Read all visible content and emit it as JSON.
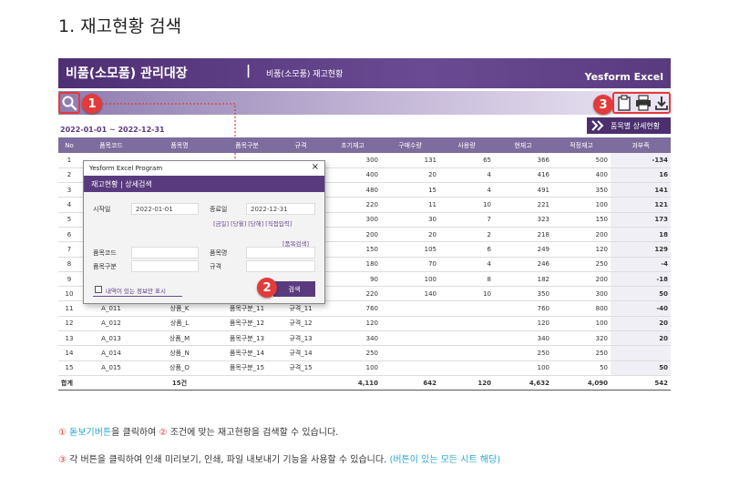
{
  "title": "1. 재고현황 검색",
  "header": {
    "title": "비품(소모품) 관리대장",
    "divider": "|",
    "subtitle": "비품(소모품) 재고현황",
    "brand": "Yesform Excel"
  },
  "toolbar": {
    "icons": [
      "search-icon",
      "clipboard-icon",
      "print-icon",
      "download-icon"
    ]
  },
  "badges": {
    "b1": "1",
    "b2": "2",
    "b3": "3"
  },
  "detail_button": "품목별 상세현황",
  "date_range": "2022-01-01 ~ 2022-12-31",
  "table": {
    "columns": [
      "No",
      "품목코드",
      "품목명",
      "품목구분",
      "규격",
      "초기재고",
      "구매수량",
      "사용량",
      "현재고",
      "적정재고",
      "과부족"
    ],
    "rows": [
      [
        "1",
        "",
        "",
        "",
        "",
        "300",
        "131",
        "65",
        "366",
        "500",
        "-134"
      ],
      [
        "2",
        "",
        "",
        "",
        "",
        "400",
        "20",
        "4",
        "416",
        "400",
        "16"
      ],
      [
        "3",
        "",
        "",
        "",
        "",
        "480",
        "15",
        "4",
        "491",
        "350",
        "141"
      ],
      [
        "4",
        "",
        "",
        "",
        "",
        "220",
        "11",
        "10",
        "221",
        "100",
        "121"
      ],
      [
        "5",
        "",
        "",
        "",
        "",
        "300",
        "30",
        "7",
        "323",
        "150",
        "173"
      ],
      [
        "6",
        "",
        "",
        "",
        "",
        "200",
        "20",
        "2",
        "218",
        "200",
        "18"
      ],
      [
        "7",
        "",
        "",
        "",
        "",
        "150",
        "105",
        "6",
        "249",
        "120",
        "129"
      ],
      [
        "8",
        "",
        "",
        "",
        "",
        "180",
        "70",
        "4",
        "246",
        "250",
        "-4"
      ],
      [
        "9",
        "",
        "",
        "",
        "",
        "90",
        "100",
        "8",
        "182",
        "200",
        "-18"
      ],
      [
        "10",
        "",
        "",
        "",
        "",
        "220",
        "140",
        "10",
        "350",
        "300",
        "50"
      ],
      [
        "11",
        "A_011",
        "상품_K",
        "품목구분_11",
        "규격_11",
        "760",
        "",
        "",
        "760",
        "800",
        "-40"
      ],
      [
        "12",
        "A_012",
        "상품_L",
        "품목구분_12",
        "규격_12",
        "120",
        "",
        "",
        "120",
        "100",
        "20"
      ],
      [
        "13",
        "A_013",
        "상품_M",
        "품목구분_13",
        "규격_13",
        "340",
        "",
        "",
        "340",
        "320",
        "20"
      ],
      [
        "14",
        "A_014",
        "상품_N",
        "품목구분_14",
        "규격_14",
        "250",
        "",
        "",
        "250",
        "250",
        ""
      ],
      [
        "15",
        "A_015",
        "상품_O",
        "품목구분_15",
        "규격_15",
        "100",
        "",
        "",
        "100",
        "50",
        "50"
      ]
    ],
    "total": [
      "합계",
      "",
      "15건",
      "",
      "",
      "4,110",
      "642",
      "120",
      "4,632",
      "4,090",
      "542"
    ]
  },
  "dialog": {
    "window_title": "Yesform Excel Program",
    "close": "×",
    "heading": "재고현황 | 상세검색",
    "start_label": "시작일",
    "start_value": "2022-01-01",
    "end_label": "종료일",
    "end_value": "2022-12-31",
    "quick_links": "[금일] [당월] [당해] [직접입력]",
    "item_search_link": "[품목검색]",
    "code_label": "품목코드",
    "name_label": "품목명",
    "type_label": "품목구분",
    "spec_label": "규격",
    "checkbox_label": "내역이 있는 정보만 표시",
    "search_button": "검색"
  },
  "notes": {
    "n1_circle1": "①",
    "n1_a": "돋보기버튼",
    "n1_b": "을 클릭하여",
    "n1_circle2": "②",
    "n1_c": "조건에 맞는 재고현황을 검색할 수 있습니다.",
    "n2_circle3": "③",
    "n2_a": "각 버튼을 클릭하여 인쇄 미리보기, 인쇄, 파일 내보내기 기능을 사용할 수 있습니다.",
    "n2_b": "(버튼이 있는 모든 시트 해당)"
  },
  "colors": {
    "accent": "#5a3a7f",
    "callout": "#e23b3b",
    "link_blue": "#2aa6d0",
    "negative": "#e02020"
  }
}
